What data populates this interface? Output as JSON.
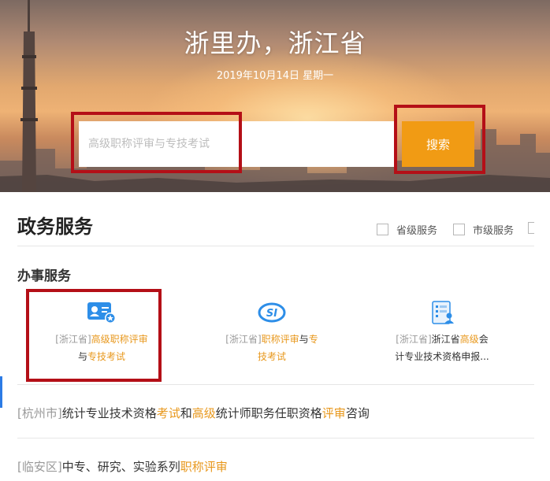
{
  "hero": {
    "title": "浙里办，浙江省",
    "date": "2019年10月14日 星期一"
  },
  "search": {
    "placeholder": "高级职称评审与专技考试",
    "button_label": "搜索"
  },
  "section": {
    "title": "政务服务",
    "filters": [
      "省级服务",
      "市级服务"
    ]
  },
  "subsection": {
    "title": "办事服务"
  },
  "services": [
    {
      "prefix": "[浙江省]",
      "segments": [
        {
          "t": "高级职称评审",
          "hl": true
        }
      ],
      "line2": [
        {
          "t": "与",
          "hl": false
        },
        {
          "t": "专技考试",
          "hl": true
        }
      ]
    },
    {
      "prefix": "[浙江省]",
      "segments": [
        {
          "t": "职称评审",
          "hl": true
        },
        {
          "t": "与",
          "hl": false
        },
        {
          "t": "专",
          "hl": true
        }
      ],
      "line2": [
        {
          "t": "技考试",
          "hl": true
        }
      ]
    },
    {
      "prefix": "[浙江省]",
      "segments": [
        {
          "t": "浙江省",
          "hl": false
        },
        {
          "t": "高级",
          "hl": true
        },
        {
          "t": "会",
          "hl": false
        }
      ],
      "line2": [
        {
          "t": "计专业技术资格申报...",
          "hl": false
        }
      ]
    }
  ],
  "list": [
    {
      "prefix": "[杭州市]",
      "segments": [
        {
          "t": "统计专业技术资格",
          "hl": false
        },
        {
          "t": "考试",
          "hl": true
        },
        {
          "t": "和",
          "hl": false
        },
        {
          "t": "高级",
          "hl": true
        },
        {
          "t": "统计师职务任职资格",
          "hl": false
        },
        {
          "t": "评审",
          "hl": true
        },
        {
          "t": "咨询",
          "hl": false
        }
      ]
    },
    {
      "prefix": "[临安区]",
      "segments": [
        {
          "t": "中专、研究、实验系列",
          "hl": false
        },
        {
          "t": "职称评审",
          "hl": true
        }
      ]
    }
  ],
  "colors": {
    "accent_orange": "#f19b14",
    "highlight_red": "#b40f17",
    "keyword_orange": "#e8981d"
  }
}
